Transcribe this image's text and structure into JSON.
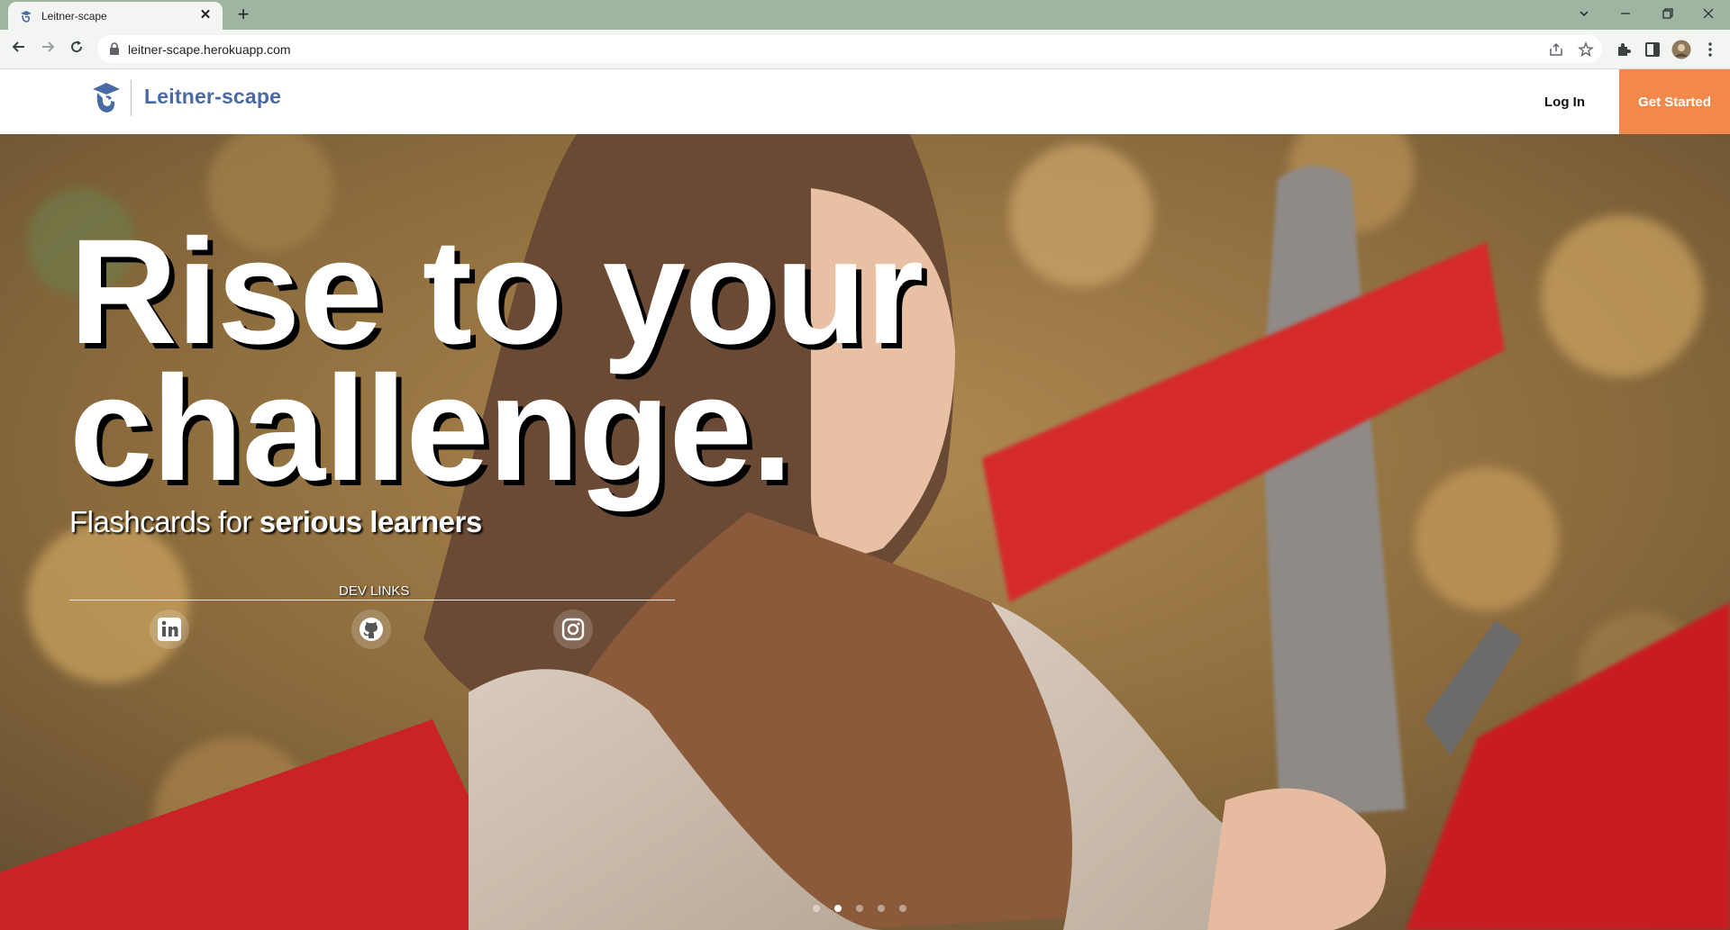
{
  "browser": {
    "tab_title": "Leitner-scape",
    "url": "leitner-scape.herokuapp.com"
  },
  "header": {
    "site_name": "Leitner-scape",
    "login_label": "Log In",
    "cta_label": "Get Started",
    "cta_color": "#f2894a",
    "brand_color": "#4a6aa6"
  },
  "hero": {
    "headline_line1": "Rise to your",
    "headline_line2": "challenge.",
    "tagline_prefix": "Flashcards for ",
    "tagline_strong": "serious learners",
    "dev_links_label": "DEV LINKS",
    "social_links": [
      "linkedin-icon",
      "github-icon",
      "instagram-icon"
    ],
    "carousel": {
      "slides": 5,
      "active_index": 1
    }
  }
}
